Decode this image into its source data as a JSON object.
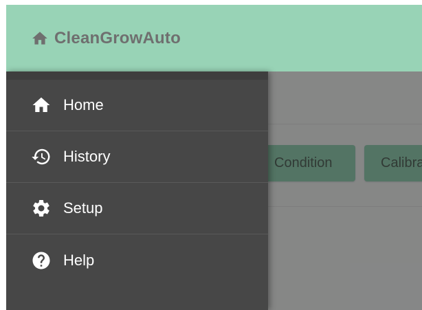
{
  "app": {
    "title": "CleanGrowAuto",
    "brand_icon": "home-icon"
  },
  "colors": {
    "appbar": "#98d3b6",
    "title_text": "#6f6f6f",
    "drawer_bg": "#474747",
    "drawer_text": "#ffffff",
    "button_bg": "#98d3b6",
    "scrim": "rgba(0,0,0,0.45)"
  },
  "main": {
    "buttons": [
      {
        "label": "Condition"
      },
      {
        "label": "Calibrate"
      }
    ]
  },
  "drawer": {
    "items": [
      {
        "label": "Home",
        "icon": "home-icon"
      },
      {
        "label": "History",
        "icon": "history-icon"
      },
      {
        "label": "Setup",
        "icon": "gear-icon"
      },
      {
        "label": "Help",
        "icon": "help-icon"
      }
    ]
  }
}
